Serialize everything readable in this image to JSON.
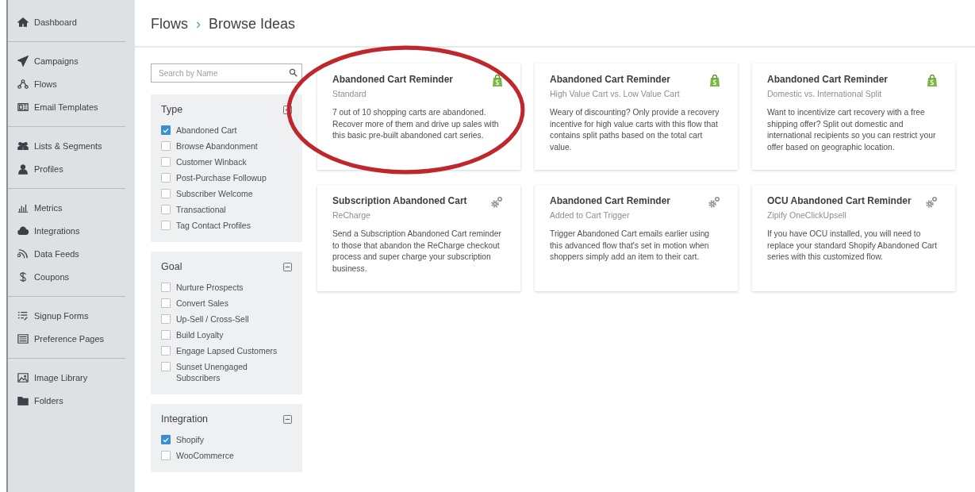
{
  "sidebar": {
    "groups": [
      [
        {
          "label": "Dashboard"
        }
      ],
      [
        {
          "label": "Campaigns"
        },
        {
          "label": "Flows"
        },
        {
          "label": "Email Templates"
        }
      ],
      [
        {
          "label": "Lists & Segments"
        },
        {
          "label": "Profiles"
        }
      ],
      [
        {
          "label": "Metrics"
        },
        {
          "label": "Integrations"
        },
        {
          "label": "Data Feeds"
        },
        {
          "label": "Coupons"
        }
      ],
      [
        {
          "label": "Signup Forms"
        },
        {
          "label": "Preference Pages"
        }
      ],
      [
        {
          "label": "Image Library"
        },
        {
          "label": "Folders"
        }
      ]
    ]
  },
  "breadcrumb": {
    "parent": "Flows",
    "separator": "›",
    "current": "Browse Ideas"
  },
  "search": {
    "placeholder": "Search by Name"
  },
  "filters": [
    {
      "title": "Type",
      "expanded": true,
      "options": [
        {
          "label": "Abandoned Cart",
          "checked": true
        },
        {
          "label": "Browse Abandonment",
          "checked": false
        },
        {
          "label": "Customer Winback",
          "checked": false
        },
        {
          "label": "Post-Purchase Followup",
          "checked": false
        },
        {
          "label": "Subscriber Welcome",
          "checked": false
        },
        {
          "label": "Transactional",
          "checked": false
        },
        {
          "label": "Tag Contact Profiles",
          "checked": false
        }
      ]
    },
    {
      "title": "Goal",
      "expanded": true,
      "options": [
        {
          "label": "Nurture Prospects",
          "checked": false
        },
        {
          "label": "Convert Sales",
          "checked": false
        },
        {
          "label": "Up-Sell / Cross-Sell",
          "checked": false
        },
        {
          "label": "Build Loyalty",
          "checked": false
        },
        {
          "label": "Engage Lapsed Customers",
          "checked": false
        },
        {
          "label": "Sunset Unengaged Subscribers",
          "checked": false
        }
      ]
    },
    {
      "title": "Integration",
      "expanded": true,
      "options": [
        {
          "label": "Shopify",
          "checked": true
        },
        {
          "label": "WooCommerce",
          "checked": false
        }
      ]
    }
  ],
  "cards": [
    {
      "title": "Abandoned Cart Reminder",
      "subtitle": "Standard",
      "kind": "shopify",
      "highlighted": true,
      "description": "7 out of 10 shopping carts are abandoned. Recover more of them and drive up sales with this basic pre-built abandoned cart series."
    },
    {
      "title": "Abandoned Cart Reminder",
      "subtitle": "High Value Cart vs. Low Value Cart",
      "kind": "shopify",
      "highlighted": false,
      "description": "Weary of discounting? Only provide a recovery incentive for high value carts with this flow that contains split paths based on the total cart value."
    },
    {
      "title": "Abandoned Cart Reminder",
      "subtitle": "Domestic vs. International Split",
      "kind": "shopify",
      "highlighted": false,
      "description": "Want to incentivize cart recovery with a free shipping offer? Split out domestic and international recipients so you can restrict your offer based on geographic location."
    },
    {
      "title": "Subscription Abandoned Cart",
      "subtitle": "ReCharge",
      "kind": "gear",
      "highlighted": false,
      "description": "Send a Subscription Abandoned Cart reminder to those that abandon the ReCharge checkout process and super charge your subscription business."
    },
    {
      "title": "Abandoned Cart Reminder",
      "subtitle": "Added to Cart Trigger",
      "kind": "gear",
      "highlighted": false,
      "description": "Trigger Abandoned Cart emails earlier using this advanced flow that's set in motion when shoppers simply add an item to their cart."
    },
    {
      "title": "OCU Abandoned Cart Reminder",
      "subtitle": "Zipify OneClickUpsell",
      "kind": "gear",
      "highlighted": false,
      "description": "If you have OCU installed, you will need to replace your standard Shopify Abandoned Cart series with this customized flow."
    }
  ]
}
